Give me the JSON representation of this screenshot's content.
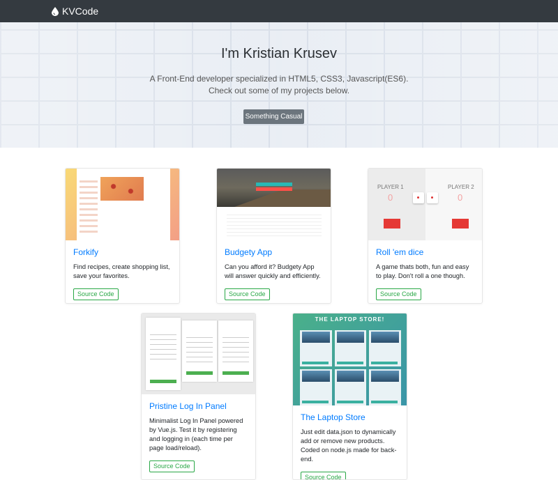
{
  "nav": {
    "brand": "KVCode",
    "brand_icon": "drop-icon"
  },
  "hero": {
    "title": "I'm Kristian Krusev",
    "lead_line1": "A Front-End developer specialized in HTML5, CSS3, Javascript(ES6).",
    "lead_line2": "Check out some of my projects below.",
    "button": "Something Casual"
  },
  "projects": [
    {
      "title": "Forkify",
      "description": "Find recipes, create shopping list, save your favorites.",
      "link": "Source Code"
    },
    {
      "title": "Budgety App",
      "description": "Can you afford it? Budgety App will answer quickly and efficiently.",
      "link": "Source Code"
    },
    {
      "title": "Roll 'em dice",
      "description": "A game thats both, fun and easy to play. Don't roll a one though.",
      "link": "Source Code"
    },
    {
      "title": "Pristine Log In Panel",
      "description": "Minimalist Log In Panel powered by Vue.js. Test it by registering and logging in (each time per page load/reload).",
      "link": "Source Code"
    },
    {
      "title": "The Laptop Store",
      "description": "Just edit data.json to dynamically add or remove new products. Coded on node.js made for back-end.",
      "link": "Source Code"
    }
  ],
  "thumb_text": {
    "dice_player1": "PLAYER 1",
    "dice_player2": "PLAYER 2",
    "dice_score": "0",
    "laptop_title": "THE LAPTOP STORE!"
  },
  "colors": {
    "navbar": "#343a40",
    "link": "#007bff",
    "source_button": "#28a745",
    "hero_button": "#6c757d"
  }
}
